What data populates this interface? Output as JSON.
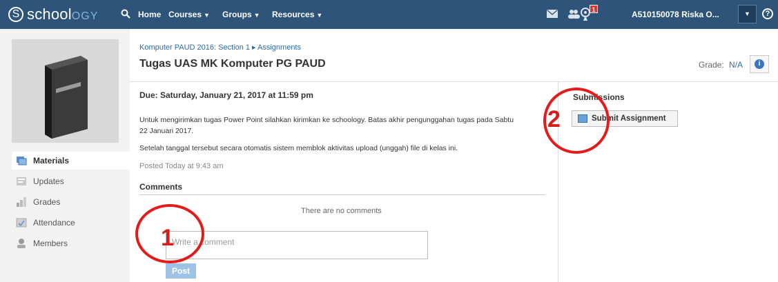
{
  "nav": {
    "logo_letter": "S",
    "logo_main": "school",
    "logo_tail": "OGY",
    "links": {
      "home": "Home",
      "courses": "Courses",
      "groups": "Groups",
      "resources": "Resources"
    },
    "notification_count": "1",
    "user": "A510150078 Riska O...",
    "help": "?"
  },
  "breadcrumb": "Komputer PAUD 2016: Section 1 ▸ Assignments",
  "title": "Tugas UAS MK Komputer PG PAUD",
  "grade": {
    "label": "Grade:",
    "value": "N/A"
  },
  "assignment": {
    "due": "Due: Saturday, January 21, 2017 at 11:59 pm",
    "line1": "Untuk mengirimkan tugas Power Point silahkan kirimkan ke schoology. Batas akhir pengunggahan tugas pada Sabtu",
    "line2": "22 Januari 2017.",
    "line3": "Setelah tanggal tersebut secara otomatis sistem memblok aktivitas upload (unggah) file di kelas ini.",
    "posted": "Posted Today at 9:43 am"
  },
  "comments": {
    "heading": "Comments",
    "empty": "There are no comments",
    "placeholder": "Write a comment",
    "post": "Post"
  },
  "submissions": {
    "heading": "Submissions",
    "button": "Submit Assignment"
  },
  "sidebar": {
    "items": [
      {
        "label": "Materials",
        "icon": "materials-icon"
      },
      {
        "label": "Updates",
        "icon": "updates-icon"
      },
      {
        "label": "Grades",
        "icon": "grades-icon"
      },
      {
        "label": "Attendance",
        "icon": "attendance-icon"
      },
      {
        "label": "Members",
        "icon": "members-icon"
      }
    ]
  },
  "annotations": {
    "one": "1",
    "two": "2",
    "color": "#e41b1b"
  },
  "colors": {
    "topbar": "#2e5579",
    "link": "#2e6aa3"
  }
}
